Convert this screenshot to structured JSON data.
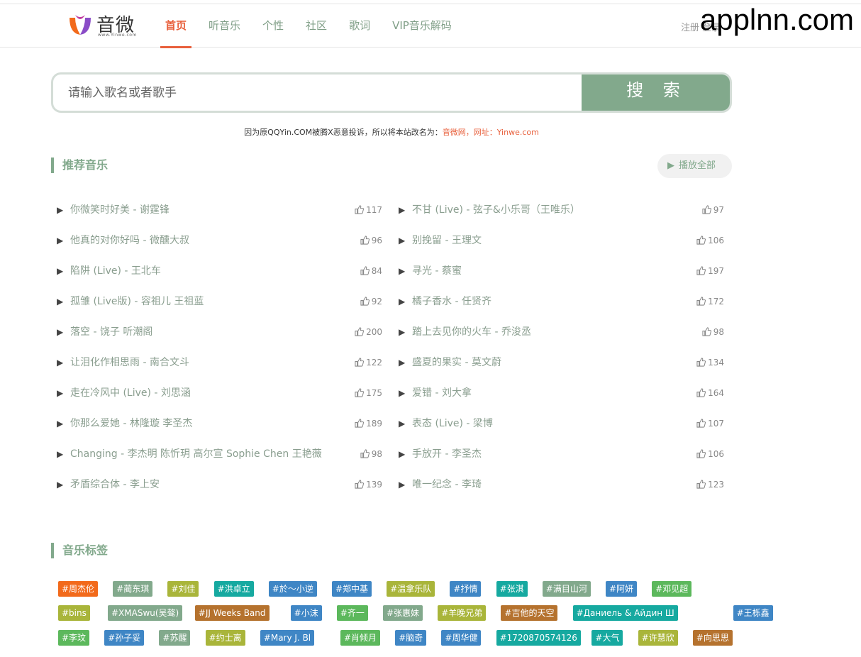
{
  "brand": {
    "name": "音微",
    "sub": "www.Yinwe.com"
  },
  "nav": [
    {
      "label": "首页",
      "active": true
    },
    {
      "label": "听音乐"
    },
    {
      "label": "个性"
    },
    {
      "label": "社区"
    },
    {
      "label": "歌词"
    },
    {
      "label": "VIP音乐解码"
    }
  ],
  "header_right": "注册 登录",
  "watermark": "applnn.com",
  "search": {
    "placeholder": "请输入歌名或者歌手",
    "button": "搜 索"
  },
  "notice": {
    "text": "因为原QQYin.COM被腾X恶意投诉，所以将本站改名为：",
    "highlight": "音微网，网址：Yinwe.com"
  },
  "recommend": {
    "title": "推荐音乐",
    "play_all": "播放全部",
    "left": [
      {
        "title": "你微笑时好美 - 谢霆锋",
        "likes": "117"
      },
      {
        "title": "他真的对你好吗 - 微醺大叔",
        "likes": "96"
      },
      {
        "title": "陷阱 (Live) - 王北车",
        "likes": "84"
      },
      {
        "title": "孤雏 (Live版) - 容祖儿 王祖蓝",
        "likes": "92"
      },
      {
        "title": "落空 - 饶子 听潮阁",
        "likes": "200"
      },
      {
        "title": "让泪化作相思雨 - 南合文斗",
        "likes": "122"
      },
      {
        "title": "走在冷风中 (Live) - 刘思涵",
        "likes": "175"
      },
      {
        "title": "你那么爱她 - 林隆璇 李圣杰",
        "likes": "189"
      },
      {
        "title": "Changing - 李杰明 陈忻玥 高尔宣 Sophie Chen 王艳薇",
        "likes": "98"
      },
      {
        "title": "矛盾综合体 - 李上安",
        "likes": "139"
      }
    ],
    "right": [
      {
        "title": "不甘 (Live) - 弦子&小乐哥（王唯乐）",
        "likes": "97"
      },
      {
        "title": "别挽留 - 王理文",
        "likes": "106"
      },
      {
        "title": "寻光 - 蔡蜜",
        "likes": "197"
      },
      {
        "title": "橘子香水 - 任贤齐",
        "likes": "172"
      },
      {
        "title": "踏上去见你的火车 - 乔浚丞",
        "likes": "98"
      },
      {
        "title": "盛夏的果实 - 莫文蔚",
        "likes": "134"
      },
      {
        "title": "爱错 - 刘大拿",
        "likes": "164"
      },
      {
        "title": "表态 (Live) - 梁博",
        "likes": "107"
      },
      {
        "title": "手放开 - 李圣杰",
        "likes": "106"
      },
      {
        "title": "唯一纪念 - 李琦",
        "likes": "123"
      }
    ]
  },
  "tags_section": {
    "title": "音乐标签",
    "rows": [
      [
        {
          "label": "#周杰伦",
          "color": "#f26a1b"
        },
        {
          "label": "#蔺东琪",
          "color": "#82a98c"
        },
        {
          "label": "#刘佳",
          "color": "#a9b53a"
        },
        {
          "label": "#洪卓立",
          "color": "#16a9a0"
        },
        {
          "label": "#於～小逆",
          "color": "#3f86c5"
        },
        {
          "label": "#郑中基",
          "color": "#3f86c5"
        },
        {
          "label": "#温拿乐队",
          "color": "#a9b53a"
        },
        {
          "label": "#抒情",
          "color": "#3f86c5"
        },
        {
          "label": "#张淇",
          "color": "#16a9a0"
        },
        {
          "label": "#满目山河",
          "color": "#82a98c"
        },
        {
          "label": "#阿妍",
          "color": "#3f86c5"
        },
        {
          "label": "#邓见超",
          "color": "#5cb85c"
        }
      ],
      [
        {
          "label": "#bins",
          "color": "#a9b53a"
        },
        {
          "label": "#XMASwu(吴骜)",
          "color": "#82a98c"
        },
        {
          "label": "#JJ Weeks Band",
          "color": "#b5722e"
        },
        {
          "label": "#小沫",
          "color": "#3f86c5"
        },
        {
          "label": "#齐一",
          "color": "#5cb85c"
        },
        {
          "label": "#张惠妹",
          "color": "#82a98c"
        },
        {
          "label": "#羊晚兄弟",
          "color": "#a9b53a"
        },
        {
          "label": "#吉他的天空",
          "color": "#b5722e"
        },
        {
          "label": "#Даниель & Айдин Ш",
          "color": "#16a9a0"
        },
        {
          "label": "#王栎鑫",
          "color": "#3f86c5"
        }
      ],
      [
        {
          "label": "#李玟",
          "color": "#5cb85c"
        },
        {
          "label": "#孙子妥",
          "color": "#3f86c5"
        },
        {
          "label": "#苏醒",
          "color": "#82a98c"
        },
        {
          "label": "#约士离",
          "color": "#a9b53a"
        },
        {
          "label": "#Mary J. Bl",
          "color": "#3f86c5"
        },
        {
          "label": "#肖倾月",
          "color": "#5cb85c"
        },
        {
          "label": "#脑奇",
          "color": "#3f86c5"
        },
        {
          "label": "#周华健",
          "color": "#3f86c5"
        },
        {
          "label": "#1720870574126",
          "color": "#16a9a0"
        },
        {
          "label": "#大气",
          "color": "#16a9a0"
        },
        {
          "label": "#许慧欣",
          "color": "#a9b53a"
        },
        {
          "label": "#向思思",
          "color": "#b5722e"
        }
      ]
    ]
  },
  "colors": {
    "accent": "#e8603c",
    "theme": "#82a98c"
  }
}
